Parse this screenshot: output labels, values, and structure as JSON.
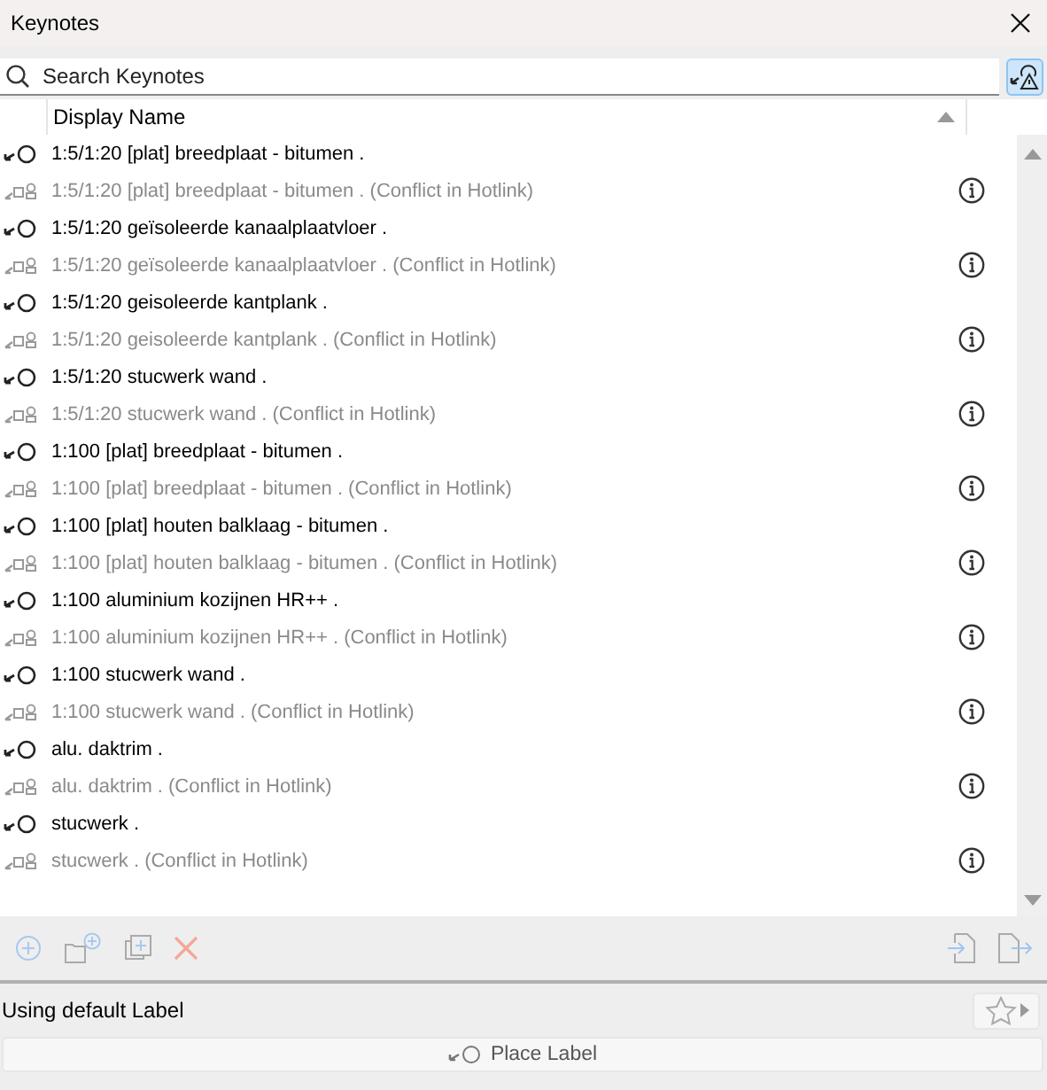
{
  "window": {
    "title": "Keynotes"
  },
  "search": {
    "placeholder": "Search Keynotes"
  },
  "table": {
    "columns": [
      "Display Name"
    ],
    "rows": [
      {
        "kind": "keynote",
        "name": "1:5/1:20 [plat] breedplaat - bitumen ."
      },
      {
        "kind": "conflict",
        "name": "1:5/1:20 [plat] breedplaat - bitumen . (Conflict in Hotlink)"
      },
      {
        "kind": "keynote",
        "name": "1:5/1:20 geïsoleerde kanaalplaatvloer ."
      },
      {
        "kind": "conflict",
        "name": "1:5/1:20 geïsoleerde kanaalplaatvloer . (Conflict in Hotlink)"
      },
      {
        "kind": "keynote",
        "name": "1:5/1:20 geisoleerde kantplank ."
      },
      {
        "kind": "conflict",
        "name": "1:5/1:20 geisoleerde kantplank . (Conflict in Hotlink)"
      },
      {
        "kind": "keynote",
        "name": "1:5/1:20 stucwerk wand ."
      },
      {
        "kind": "conflict",
        "name": "1:5/1:20 stucwerk wand . (Conflict in Hotlink)"
      },
      {
        "kind": "keynote",
        "name": "1:100 [plat] breedplaat - bitumen ."
      },
      {
        "kind": "conflict",
        "name": "1:100 [plat] breedplaat - bitumen . (Conflict in Hotlink)"
      },
      {
        "kind": "keynote",
        "name": "1:100 [plat] houten balklaag - bitumen ."
      },
      {
        "kind": "conflict",
        "name": "1:100 [plat] houten balklaag - bitumen . (Conflict in Hotlink)"
      },
      {
        "kind": "keynote",
        "name": "1:100 aluminium kozijnen HR++ ."
      },
      {
        "kind": "conflict",
        "name": "1:100 aluminium kozijnen HR++ . (Conflict in Hotlink)"
      },
      {
        "kind": "keynote",
        "name": "1:100 stucwerk wand ."
      },
      {
        "kind": "conflict",
        "name": "1:100 stucwerk wand . (Conflict in Hotlink)"
      },
      {
        "kind": "keynote",
        "name": "alu. daktrim ."
      },
      {
        "kind": "conflict",
        "name": "alu. daktrim . (Conflict in Hotlink)"
      },
      {
        "kind": "keynote",
        "name": "stucwerk ."
      },
      {
        "kind": "conflict",
        "name": "stucwerk . (Conflict in Hotlink)"
      }
    ]
  },
  "label_status": "Using default Label",
  "place_button": "Place Label"
}
